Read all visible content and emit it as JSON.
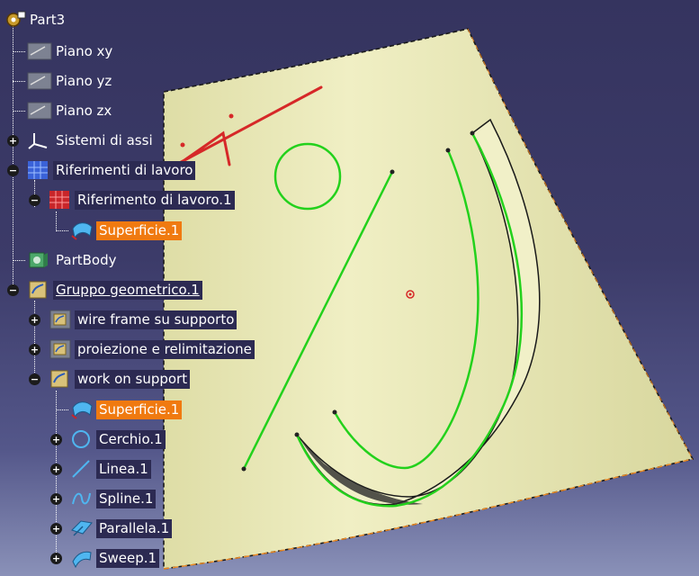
{
  "tree": {
    "root": "Part3",
    "nodes": [
      {
        "label": "Piano xy",
        "icon": "plane-icon"
      },
      {
        "label": "Piano yz",
        "icon": "plane-icon"
      },
      {
        "label": "Piano zx",
        "icon": "plane-icon"
      },
      {
        "label": "Sistemi di assi",
        "icon": "axis-system-icon",
        "expander": "+"
      },
      {
        "label": "Riferimenti di lavoro",
        "icon": "work-references-icon",
        "expander": "−"
      },
      {
        "label": "Riferimento di lavoro.1",
        "icon": "work-grid-icon",
        "expander": "−"
      },
      {
        "label": "Superficie.1",
        "icon": "surface-icon"
      },
      {
        "label": "PartBody",
        "icon": "part-body-icon"
      },
      {
        "label": "Gruppo geometrico.1",
        "icon": "geometrical-set-icon",
        "expander": "−"
      },
      {
        "label": "wire frame su supporto",
        "icon": "geometrical-set-icon",
        "expander": "+"
      },
      {
        "label": "proiezione e relimitazione",
        "icon": "geometrical-set-icon",
        "expander": "+"
      },
      {
        "label": "work on support",
        "icon": "geometrical-set-icon",
        "expander": "−"
      },
      {
        "label": "Superficie.1",
        "icon": "surface-icon"
      },
      {
        "label": "Cerchio.1",
        "icon": "circle-icon",
        "expander": "+"
      },
      {
        "label": "Linea.1",
        "icon": "line-icon",
        "expander": "+"
      },
      {
        "label": "Spline.1",
        "icon": "spline-icon",
        "expander": "+"
      },
      {
        "label": "Parallela.1",
        "icon": "parallel-icon",
        "expander": "+"
      },
      {
        "label": "Sweep.1",
        "icon": "sweep-icon",
        "expander": "+"
      }
    ]
  },
  "colors": {
    "background_top": "#35345f",
    "background_bottom": "#8a91b8",
    "surface_fill": "#e7e6b4",
    "wire_green": "#23d11c",
    "sketch_red": "#d62828",
    "selected_orange": "#f07a10",
    "label_box": "#2c2a52"
  }
}
